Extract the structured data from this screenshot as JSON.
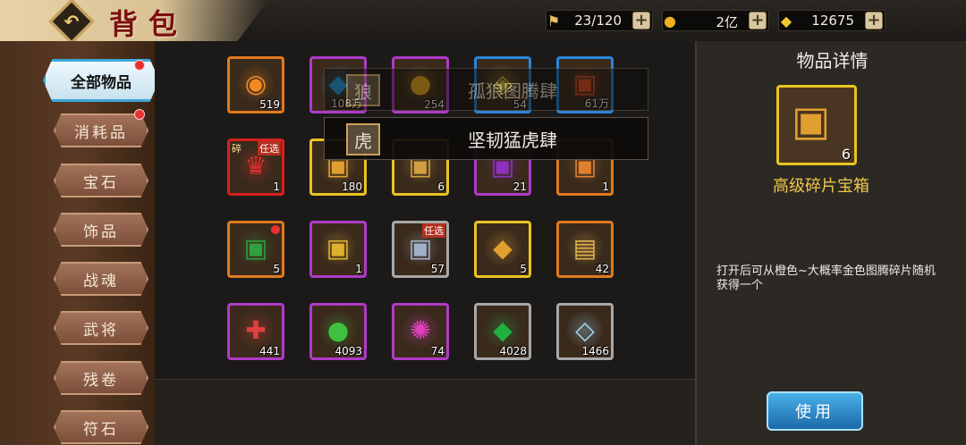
{
  "header": {
    "title": "背包",
    "resources": [
      {
        "icon": "trophy-icon",
        "glyph": "⚑",
        "value": "23/120"
      },
      {
        "icon": "gold-coin-icon",
        "glyph": "●",
        "value": "2亿"
      },
      {
        "icon": "gold-ingot-icon",
        "glyph": "◆",
        "value": "12675"
      }
    ],
    "plus_label": "+"
  },
  "sidebar": {
    "tabs": [
      {
        "label": "全部物品",
        "badge": true
      },
      {
        "label": "消耗品",
        "badge": true
      },
      {
        "label": "宝石",
        "badge": false
      },
      {
        "label": "饰品",
        "badge": false
      },
      {
        "label": "战魂",
        "badge": false
      },
      {
        "label": "武将",
        "badge": false
      },
      {
        "label": "残卷",
        "badge": false
      },
      {
        "label": "符石",
        "badge": false
      }
    ]
  },
  "grid": {
    "items": [
      {
        "icon": "orange-orb-icon",
        "count": "519",
        "rarity": "orange",
        "color": "#f08a20"
      },
      {
        "icon": "blue-egg-icon",
        "count": "108万",
        "rarity": "purple",
        "color": "#2aa0e8"
      },
      {
        "icon": "gold-coin-pile-icon",
        "count": "254",
        "rarity": "purple",
        "color": "#f0b020"
      },
      {
        "icon": "yellow-token-icon",
        "count": "54",
        "rarity": "blue",
        "color": "#d8c040"
      },
      {
        "icon": "red-scroll-icon",
        "count": "61万",
        "rarity": "blue",
        "color": "#e05020"
      },
      {
        "icon": "crown-icon",
        "count": "1",
        "rarity": "red",
        "color": "#d83030",
        "tag": "任选",
        "ltag": "碎"
      },
      {
        "icon": "gold-chest-icon",
        "count": "180",
        "rarity": "yellow",
        "color": "#e0a030"
      },
      {
        "icon": "star-fragment-chest-icon",
        "count": "6",
        "rarity": "yellow",
        "color": "#d0a040"
      },
      {
        "icon": "purple-chest-icon",
        "count": "21",
        "rarity": "purple",
        "color": "#9030c0"
      },
      {
        "icon": "orange-chest-icon",
        "count": "1",
        "rarity": "orange",
        "color": "#e08030"
      },
      {
        "icon": "green-chest-icon",
        "count": "5",
        "rarity": "orange",
        "color": "#30a040",
        "dot": true
      },
      {
        "icon": "golden-box-icon",
        "count": "1",
        "rarity": "purple",
        "color": "#e0b030"
      },
      {
        "icon": "silver-chest-icon",
        "count": "57",
        "rarity": "gray",
        "color": "#a0b0c8",
        "tag": "任选"
      },
      {
        "icon": "gold-gem-icon",
        "count": "5",
        "rarity": "yellow",
        "color": "#e0a030"
      },
      {
        "icon": "golden-scroll-icon",
        "count": "42",
        "rarity": "orange",
        "color": "#e0b050"
      },
      {
        "icon": "red-puzzle-icon",
        "count": "441",
        "rarity": "purple",
        "color": "#e04040"
      },
      {
        "icon": "green-orb-icon",
        "count": "4093",
        "rarity": "purple",
        "color": "#40c040"
      },
      {
        "icon": "pink-energy-icon",
        "count": "74",
        "rarity": "purple",
        "color": "#e040c0"
      },
      {
        "icon": "green-gem-icon",
        "count": "4028",
        "rarity": "gray",
        "color": "#20b040"
      },
      {
        "icon": "crystal-icon",
        "count": "1466",
        "rarity": "gray",
        "color": "#a0d8f0"
      }
    ]
  },
  "popups": [
    {
      "text": "孤狼图腾肆",
      "icon": "wolf-icon",
      "glyph": "狼"
    },
    {
      "text": "坚韧猛虎肆",
      "icon": "tiger-icon",
      "glyph": "虎"
    }
  ],
  "detail": {
    "title": "物品详情",
    "item_count": "6",
    "item_name": "高级碎片宝箱",
    "description": "打开后可从橙色~大概率金色图腾碎片随机获得一个",
    "use_button": "使用"
  }
}
